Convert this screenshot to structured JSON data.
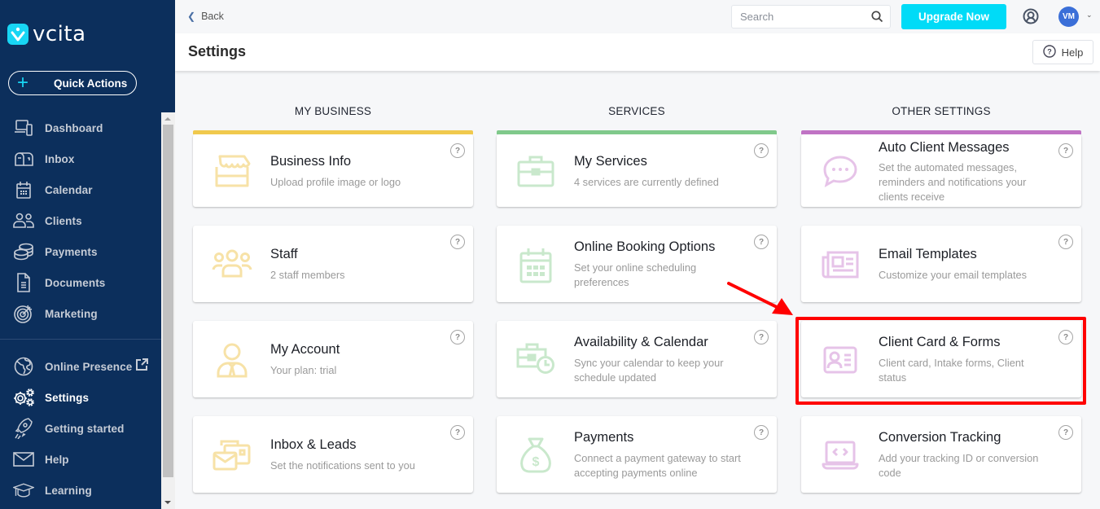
{
  "app": {
    "logo_text": "vcita"
  },
  "sidebar": {
    "quick_actions_label": "Quick Actions",
    "items_top": [
      {
        "label": "Dashboard",
        "icon": "dashboard-icon"
      },
      {
        "label": "Inbox",
        "icon": "inbox-icon"
      },
      {
        "label": "Calendar",
        "icon": "calendar-icon"
      },
      {
        "label": "Clients",
        "icon": "clients-icon"
      },
      {
        "label": "Payments",
        "icon": "payments-icon"
      },
      {
        "label": "Documents",
        "icon": "documents-icon"
      },
      {
        "label": "Marketing",
        "icon": "marketing-icon"
      }
    ],
    "items_bottom": [
      {
        "label": "Online Presence",
        "icon": "globe-icon"
      },
      {
        "label": "Settings",
        "icon": "settings-icon",
        "active": true
      },
      {
        "label": "Getting started",
        "icon": "rocket-icon"
      },
      {
        "label": "Help",
        "icon": "envelope-icon"
      },
      {
        "label": "Learning",
        "icon": "graduation-cap-icon"
      }
    ]
  },
  "topbar": {
    "back_label": "Back",
    "search_placeholder": "Search",
    "upgrade_label": "Upgrade Now",
    "avatar_initials": "VM"
  },
  "page": {
    "title": "Settings",
    "help_label": "Help"
  },
  "columns": [
    {
      "title": "MY BUSINESS",
      "accent": "#f0c94d",
      "icon_color": "#f7e2a7",
      "cards": [
        {
          "title": "Business Info",
          "desc": "Upload profile image or logo",
          "icon": "storefront-icon"
        },
        {
          "title": "Staff",
          "desc": "2 staff members",
          "icon": "staff-icon"
        },
        {
          "title": "My Account",
          "desc": "Your plan: trial",
          "icon": "account-icon"
        },
        {
          "title": "Inbox & Leads",
          "desc": "Set the notifications sent to you",
          "icon": "inbox-leads-icon"
        }
      ]
    },
    {
      "title": "SERVICES",
      "accent": "#80c98b",
      "icon_color": "#c9e8cc",
      "cards": [
        {
          "title": "My Services",
          "desc": "4 services are currently defined",
          "icon": "briefcase-icon"
        },
        {
          "title": "Online Booking Options",
          "desc": "Set your online scheduling preferences",
          "icon": "calendar-icon"
        },
        {
          "title": "Availability & Calendar",
          "desc": "Sync your calendar to keep your schedule updated",
          "icon": "briefcase-clock-icon"
        },
        {
          "title": "Payments",
          "desc": "Connect a payment gateway to start accepting payments online",
          "icon": "money-bag-icon"
        }
      ]
    },
    {
      "title": "OTHER SETTINGS",
      "accent": "#c073c4",
      "icon_color": "#e6c3e8",
      "cards": [
        {
          "title": "Auto Client Messages",
          "desc": "Set the automated messages, reminders and notifications your clients receive",
          "icon": "chat-bubble-icon"
        },
        {
          "title": "Email Templates",
          "desc": "Customize your email templates",
          "icon": "newspaper-icon"
        },
        {
          "title": "Client Card & Forms",
          "desc": "Client card, Intake forms, Client status",
          "icon": "id-card-icon",
          "highlighted": true
        },
        {
          "title": "Conversion Tracking",
          "desc": "Add your tracking ID or conversion code",
          "icon": "laptop-code-icon"
        }
      ]
    }
  ],
  "annotation": {
    "highlight_color": "#ff0000"
  }
}
